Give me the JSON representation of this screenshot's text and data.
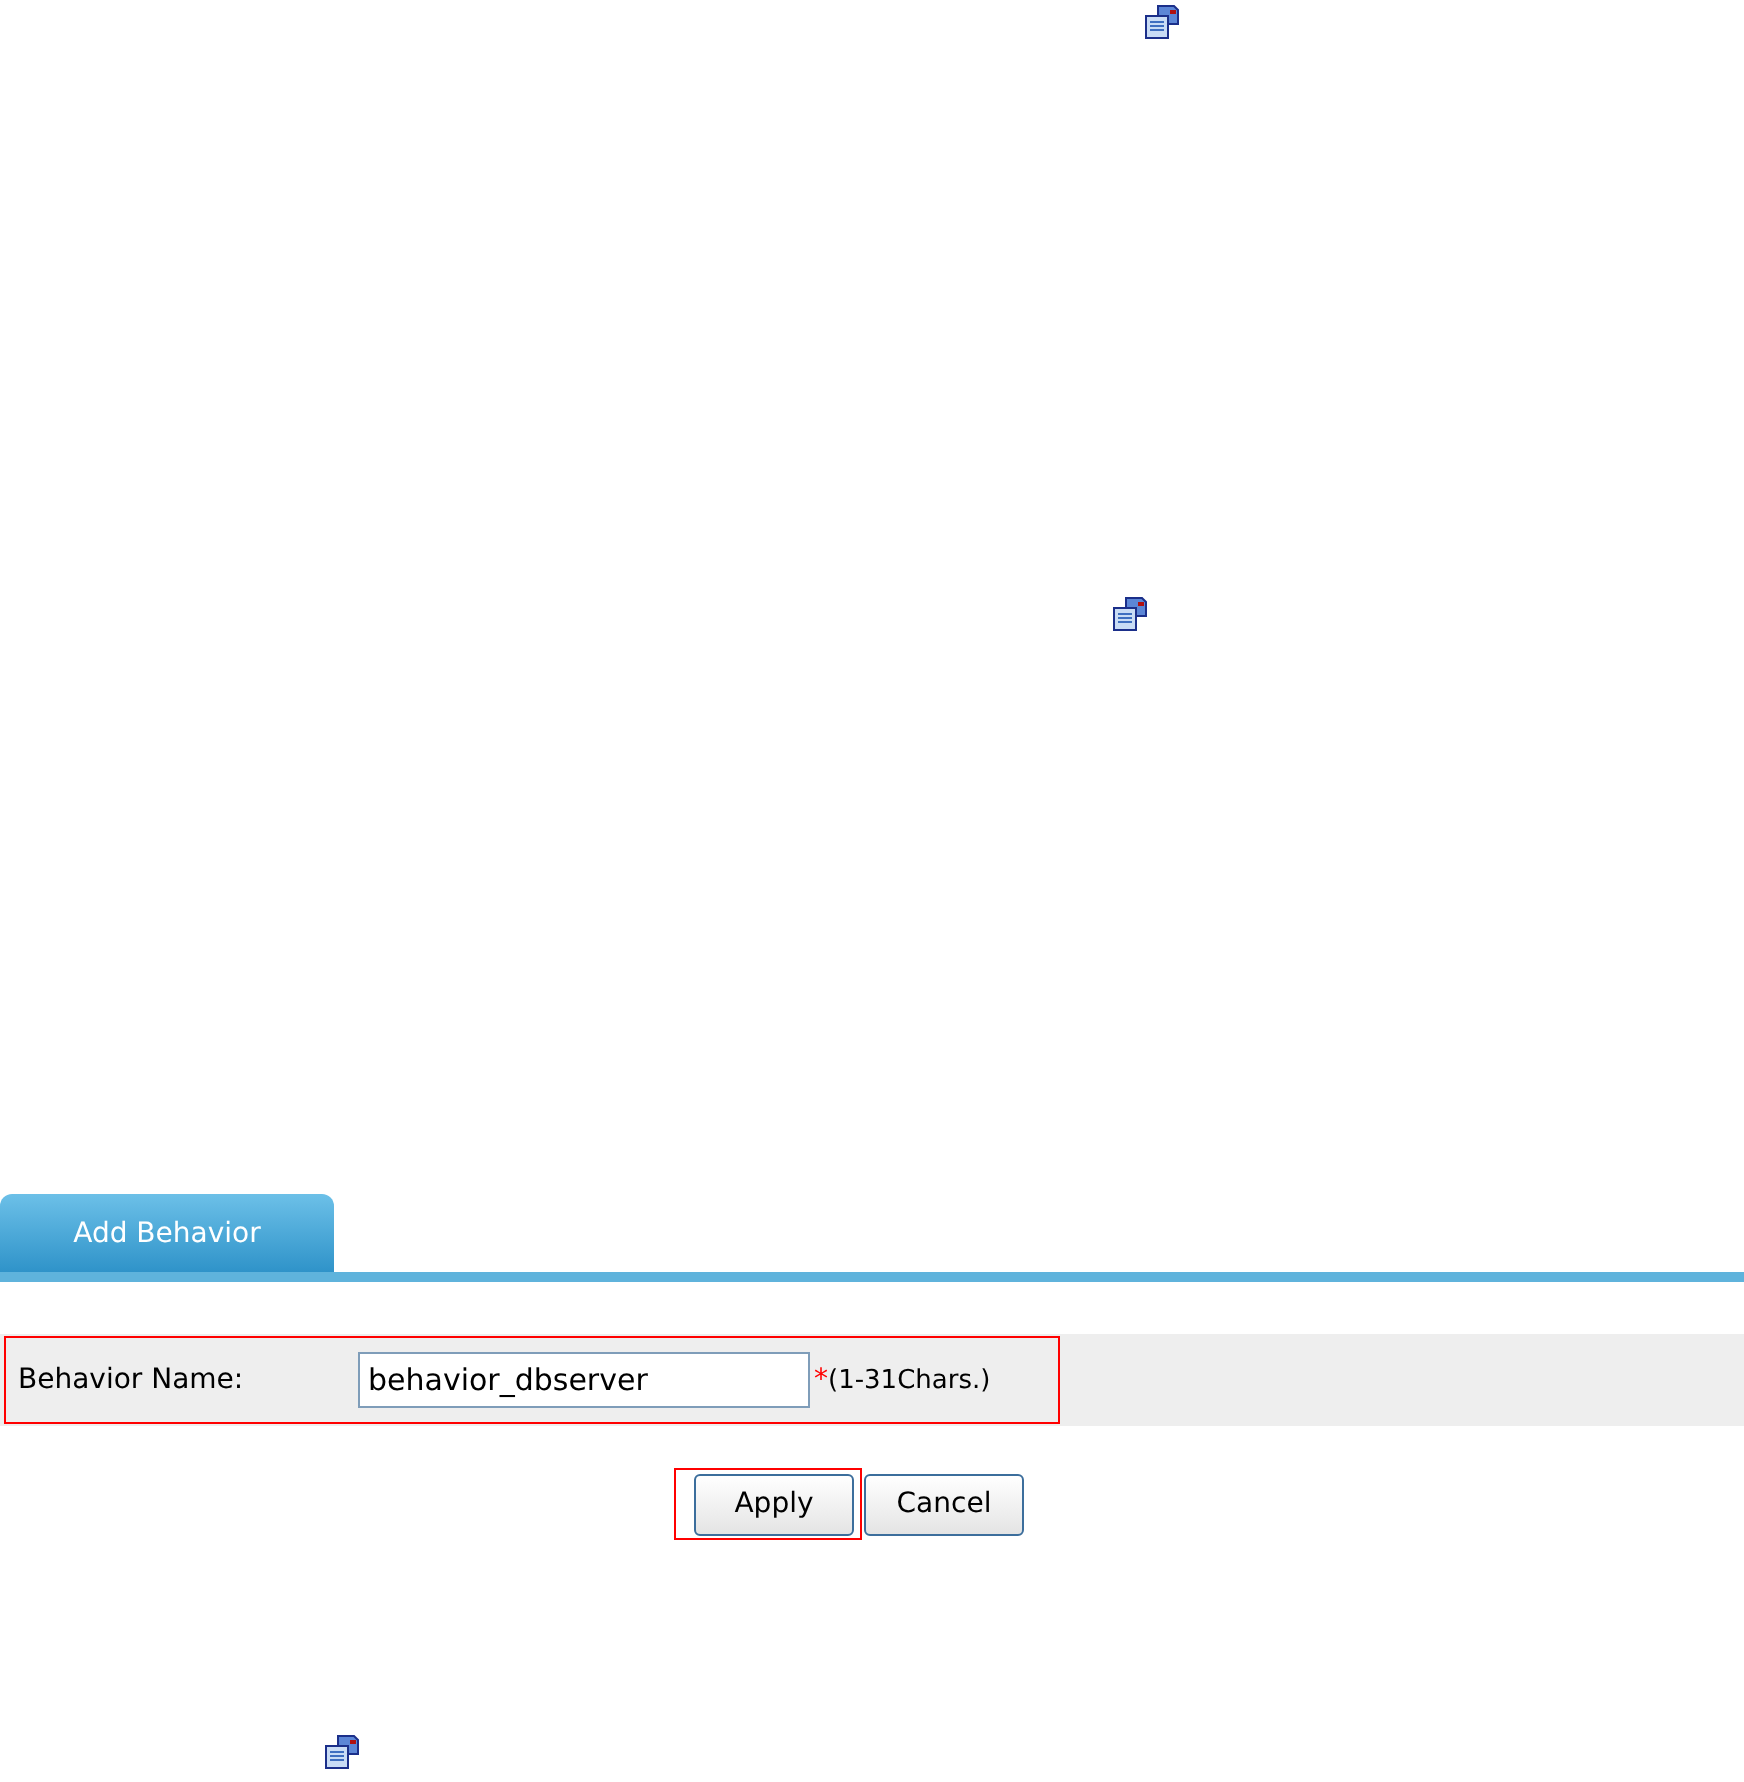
{
  "tabs": [
    {
      "label": "Add Behavior",
      "selected": true
    }
  ],
  "form": {
    "label": "Behavior Name:",
    "value": "behavior_dbserver",
    "required_mark": "*",
    "hint": "(1-31Chars.)",
    "highlighted": true
  },
  "buttons": [
    {
      "label": "Apply",
      "highlighted": true
    },
    {
      "label": "Cancel",
      "highlighted": false
    }
  ]
}
